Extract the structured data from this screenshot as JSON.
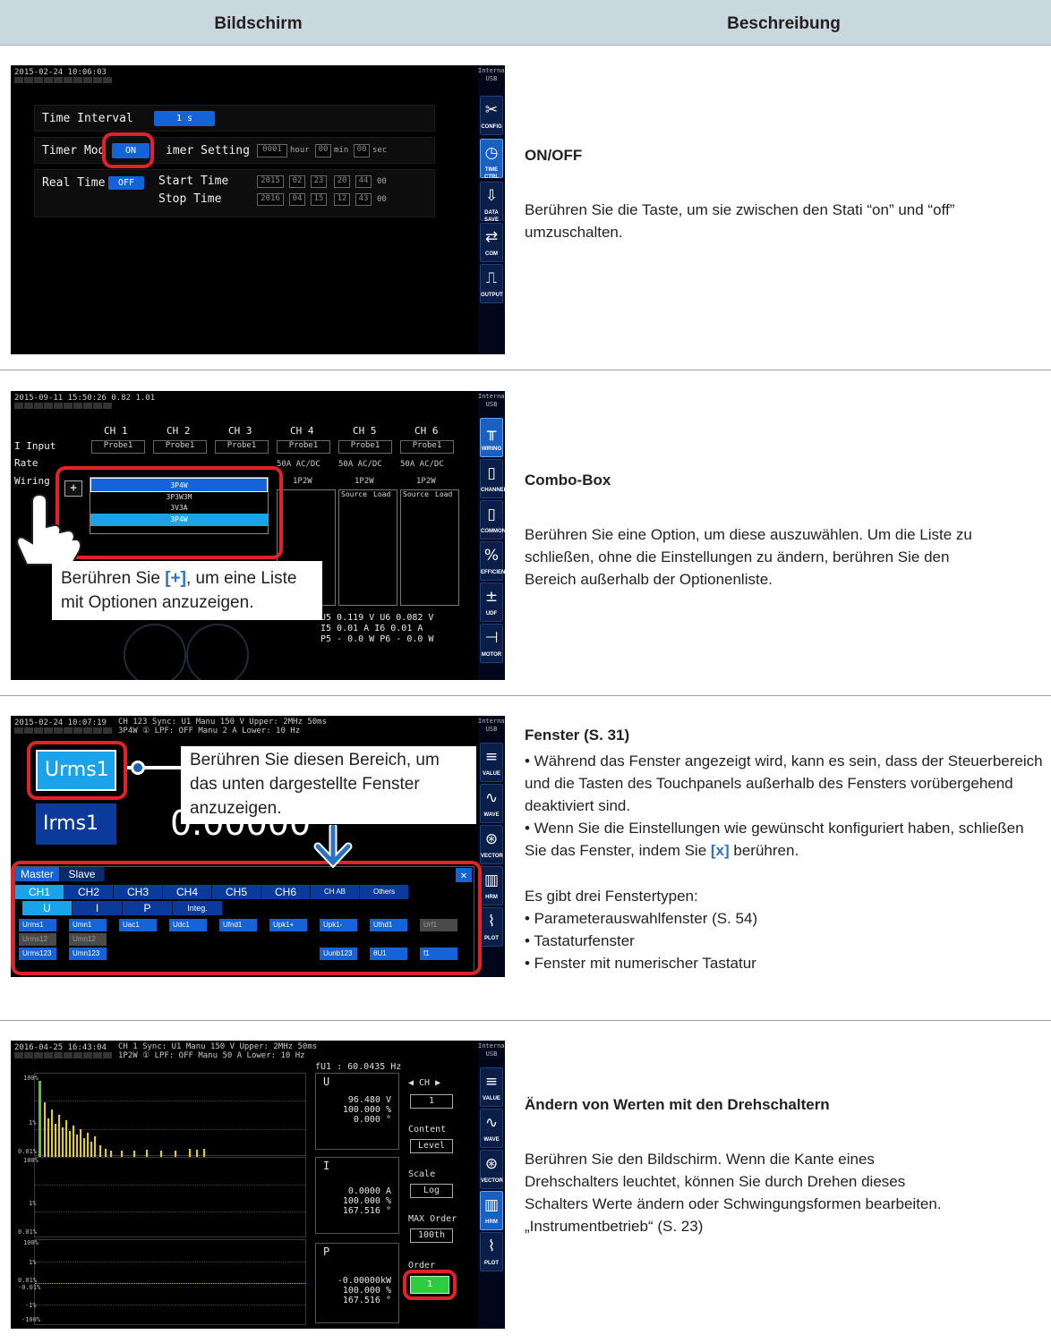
{
  "header": {
    "col_screen": "Bildschirm",
    "col_description": "Beschreibung"
  },
  "row1": {
    "screen": {
      "timestamp": "2015-02-24 10:06:03",
      "side_top": "Internal USB",
      "time_interval_label": "Time Interval",
      "time_interval_value": "1 s",
      "timer_mode_label": "Timer Mod",
      "timer_mode_value": "ON",
      "timer_setting_label": "imer Setting",
      "timer_hour": "0001",
      "timer_hour_unit": "hour",
      "timer_min": "00",
      "timer_min_unit": "min",
      "timer_sec": "00",
      "timer_sec_unit": "sec",
      "real_time_label": "Real Time",
      "real_time_value": "OFF",
      "start_time_label": "Start Time",
      "stop_time_label": "Stop  Time",
      "start_y": "2015",
      "start_m": "02",
      "start_d": "23",
      "start_h": "20",
      "start_mi": "44",
      "start_s": "00",
      "stop_y": "2016",
      "stop_m": "04",
      "stop_d": "15",
      "stop_h": "12",
      "stop_mi": "43",
      "stop_s": "00",
      "side_buttons": [
        "CONFIG",
        "TIME CTRL",
        "DATA SAVE",
        "COM",
        "OUTPUT"
      ]
    },
    "title": "ON/OFF",
    "text": "Berühren Sie die Taste, um sie zwischen den Stati “on” und “off” umzuschalten."
  },
  "row2": {
    "screen": {
      "timestamp": "2015-09-11 15:50:26 0.82 1.01",
      "channels": [
        "CH 1",
        "CH 2",
        "CH 3",
        "CH 4",
        "CH 5",
        "CH 6"
      ],
      "i_input_label": "I Input",
      "rate_label": "Rate",
      "wiring_label": "Wiring",
      "probe": "Probe1",
      "rate_value": "50A AC/DC",
      "wiring_1p2w": "1P2W",
      "plus_button": "+",
      "options": [
        "3P4W",
        "3P3W3M",
        "3V3A",
        "3P4W"
      ],
      "source": "Source",
      "load": "Load",
      "readings": [
        "U5  0.119 V  U6  0.082 V",
        "I5   0.01 A  I6   0.01 A",
        "P5 -  0.0 W  P6 -  0.0 W"
      ],
      "side_buttons": [
        "WIRING",
        "CHANNEL",
        "COMMON",
        "EFFICIENCY",
        "UDF",
        "MOTOR"
      ]
    },
    "callout_before": "Berühren Sie ",
    "callout_key": "[+]",
    "callout_after": ", um eine Liste mit Optionen anzuzeigen.",
    "title": "Combo-Box",
    "text": "Berühren Sie eine Option, um diese auszuwählen. Um die Liste zu schließen, ohne die Einstellungen zu ändern, berühren Sie den Bereich außerhalb der Optionenliste."
  },
  "row3": {
    "screen": {
      "timestamp": "2015-02-24 10:07:19",
      "status": "CH 123    Sync: U1    Manu 150 V    Upper:  2MHz  50ms",
      "status2": "3P4W  ①   LPF: OFF   Manu   2 A    Lower: 10 Hz",
      "param_main": "Urms1",
      "param_second": "Irms1",
      "big_value": "0.00000",
      "tabs_top": [
        "Master",
        "Slave"
      ],
      "tabs_ch": [
        "CH1",
        "CH2",
        "CH3",
        "CH4",
        "CH5",
        "CH6",
        "CH AB",
        "Others"
      ],
      "tabs_type": [
        "U",
        "I",
        "P",
        "Integ."
      ],
      "params_row1": [
        "Urms1",
        "Umn1",
        "Uac1",
        "Udc1",
        "Ufnd1",
        "Upk1+",
        "Upk1-",
        "Uthd1",
        "Urf1"
      ],
      "params_row2": [
        "Urms12",
        "Umn12"
      ],
      "params_row3": [
        "Urms123",
        "Umn123",
        "Uunb123",
        "θU1",
        "f1"
      ],
      "close": "✕",
      "side_buttons": [
        "VALUE",
        "WAVE",
        "VECTOR",
        "HRM",
        "PLOT"
      ]
    },
    "callout": "Berühren Sie diesen Bereich, um das unten dargestellte Fenster anzuzeigen.",
    "title": "Fenster (S. 31)",
    "bullet1_a": "• Während das Fenster angezeigt wird, kann es sein, dass der Steuerbereich und die Tasten des Touchpanels außerhalb des Fensters vorübergehend deaktiviert sind.",
    "bullet2_a": "• Wenn Sie die Einstellungen wie gewünscht konfiguriert haben, schließen Sie das Fenster, indem Sie ",
    "bullet2_key": "[x]",
    "bullet2_b": " berühren.",
    "types_intro": "Es gibt drei Fenstertypen:",
    "types": [
      "• Parameterauswahlfenster (S. 54)",
      "• Tastaturfenster",
      "• Fenster mit numerischer Tastatur"
    ]
  },
  "row4": {
    "screen": {
      "timestamp": "2016-04-25 16:43:04",
      "status": "CH 1      Sync: U1    Manu 150 V    Upper:  2MHz  50ms",
      "status2": "1P2W  ①   LPF: OFF   Manu  50 A    Lower: 10 Hz",
      "fu1": "fU1  :  60.0435 Hz",
      "y_labels": [
        "100%",
        "1%",
        "0.01%"
      ],
      "y_labels3": [
        "100%",
        "1%",
        "0.01%",
        "-0.01%",
        "-1%",
        "-100%"
      ],
      "box_u_title": "U",
      "box_u_lines": [
        "96.480 V",
        "100.000 %",
        "0.000 °"
      ],
      "box_i_title": "I",
      "box_i_lines": [
        "0.0000 A",
        "100.000 %",
        "167.516 °"
      ],
      "box_p_title": "P",
      "box_p_lines": [
        "-0.00000kW",
        "100.000 %",
        "167.516 °"
      ],
      "ch_label": "◀ CH ▶",
      "ch_value": "1",
      "content_label": "Content",
      "content_value": "Level",
      "scale_label": "Scale",
      "scale_value": "Log",
      "max_order_label": "MAX Order",
      "max_order_value": "100th",
      "order_label": "Order",
      "order_value": "1",
      "side_buttons": [
        "VALUE",
        "WAVE",
        "VECTOR",
        "HRM",
        "PLOT"
      ]
    },
    "title": "Ändern von Werten mit den Drehschaltern",
    "text": "Berühren Sie den Bildschirm. Wenn die Kante eines Drehschalters leuchtet, können Sie durch Drehen dieses Schalters Werte ändern oder Schwingungsformen bearbeiten.",
    "link": "„Instrumentbetrieb“ (S. 23)"
  },
  "colors": {
    "header_bg": "#c8d8de",
    "accent_blue": "#2a72c6",
    "ring_red": "#e22129",
    "screen_btn_blue": "#1463d8"
  }
}
